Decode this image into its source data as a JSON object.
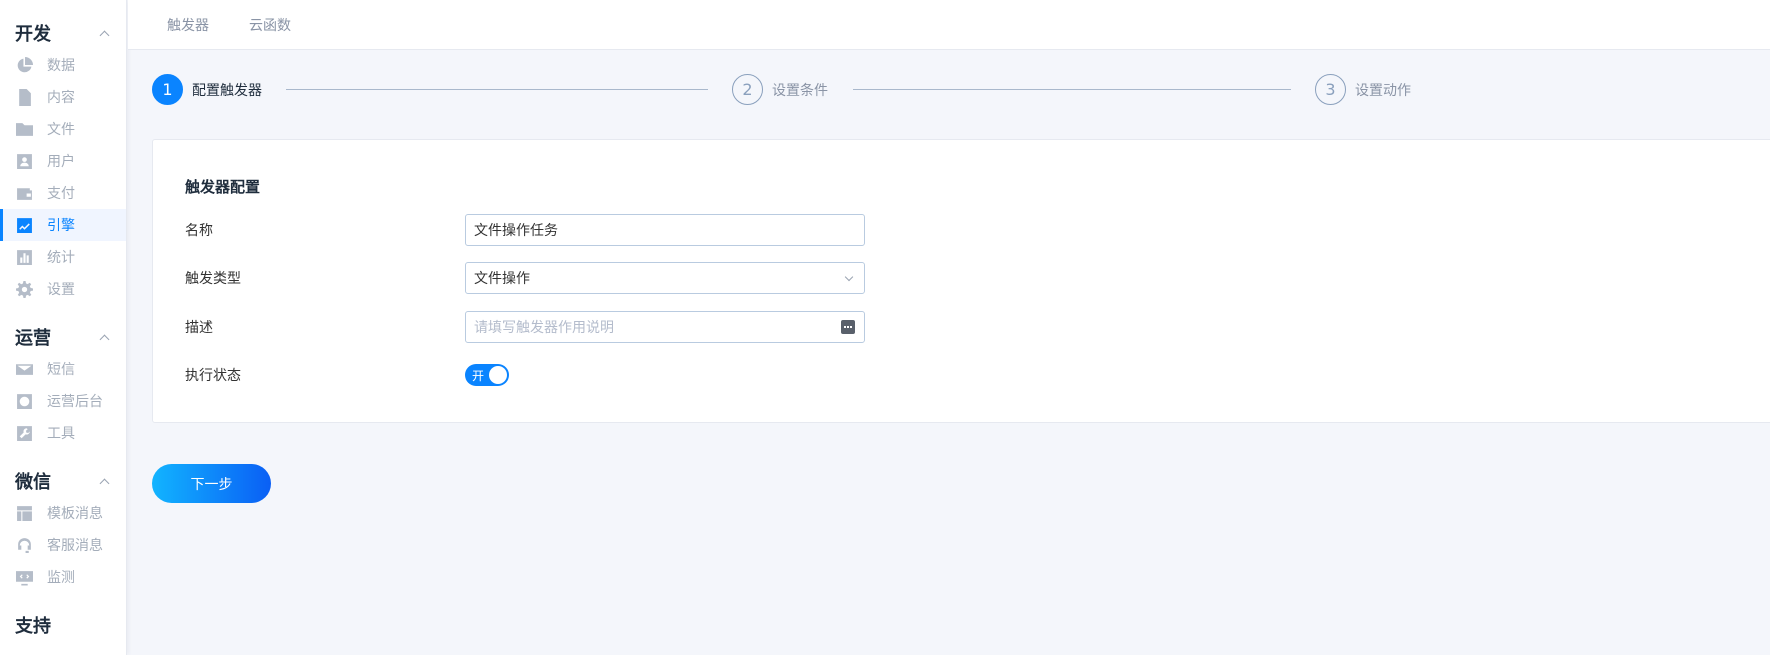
{
  "sidebar": {
    "groups": [
      {
        "title": "开发",
        "items": [
          {
            "label": "数据",
            "icon": "pie-chart-icon"
          },
          {
            "label": "内容",
            "icon": "document-icon"
          },
          {
            "label": "文件",
            "icon": "folder-icon"
          },
          {
            "label": "用户",
            "icon": "user-card-icon"
          },
          {
            "label": "支付",
            "icon": "wallet-icon"
          },
          {
            "label": "引擎",
            "icon": "trend-chart-icon",
            "active": true
          },
          {
            "label": "统计",
            "icon": "bar-chart-icon"
          },
          {
            "label": "设置",
            "icon": "gear-icon"
          }
        ]
      },
      {
        "title": "运营",
        "items": [
          {
            "label": "短信",
            "icon": "mail-icon"
          },
          {
            "label": "运营后台",
            "icon": "dashboard-icon"
          },
          {
            "label": "工具",
            "icon": "wrench-icon"
          }
        ]
      },
      {
        "title": "微信",
        "items": [
          {
            "label": "模板消息",
            "icon": "layout-icon"
          },
          {
            "label": "客服消息",
            "icon": "headset-icon"
          },
          {
            "label": "监测",
            "icon": "code-monitor-icon"
          }
        ]
      },
      {
        "title": "支持",
        "items": []
      }
    ]
  },
  "topbar": {
    "tabs": [
      {
        "label": "触发器"
      },
      {
        "label": "云函数"
      }
    ]
  },
  "steps": [
    {
      "num": "1",
      "label": "配置触发器",
      "active": true
    },
    {
      "num": "2",
      "label": "设置条件",
      "active": false
    },
    {
      "num": "3",
      "label": "设置动作",
      "active": false
    }
  ],
  "card": {
    "title": "触发器配置",
    "name_label": "名称",
    "name_value": "文件操作任务",
    "type_label": "触发类型",
    "type_value": "文件操作",
    "desc_label": "描述",
    "desc_placeholder": "请填写触发器作用说明",
    "status_label": "执行状态",
    "status_toggle_label": "开",
    "status_on": true
  },
  "next_button": "下一步",
  "colors": {
    "accent": "#0a84ff",
    "sidebar_icon": "#b5bdc9",
    "background": "#f4f6fb"
  }
}
